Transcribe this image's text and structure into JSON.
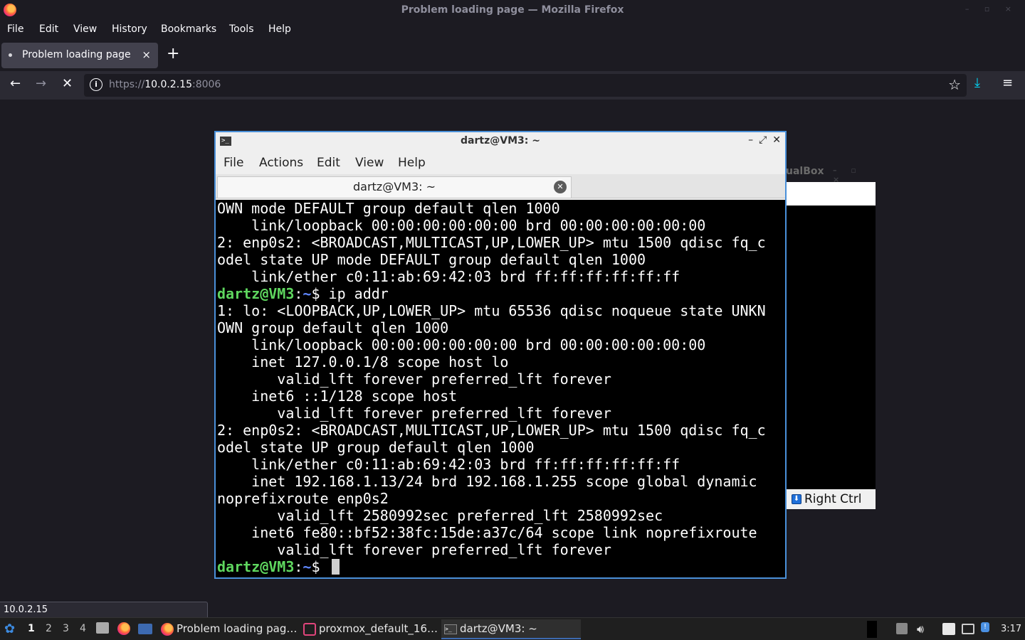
{
  "firefox": {
    "window_title": "Problem loading page — Mozilla Firefox",
    "menu": [
      "File",
      "Edit",
      "View",
      "History",
      "Bookmarks",
      "Tools",
      "Help"
    ],
    "tab_label": "Problem loading page",
    "tab_close": "×",
    "new_tab": "+",
    "url_scheme": "https://",
    "url_host": "10.0.2.15",
    "url_port": ":8006",
    "status_link": "10.0.2.15",
    "icons": [
      "back-arrow-icon",
      "forward-arrow-icon",
      "stop-icon",
      "info-icon",
      "star-icon",
      "download-icon",
      "hamburger-menu-icon"
    ]
  },
  "vbox": {
    "title_fragment": "ualBox",
    "host_key": "Right Ctrl"
  },
  "terminal": {
    "window_title": "dartz@VM3: ~",
    "menu": [
      "File",
      "Actions",
      "Edit",
      "View",
      "Help"
    ],
    "tab_label": "dartz@VM3: ~",
    "prompt_user": "dartz@VM3",
    "prompt_sep": ":",
    "prompt_path": "~",
    "prompt_sign": "$",
    "lines": [
      {
        "type": "out",
        "text": "OWN mode DEFAULT group default qlen 1000"
      },
      {
        "type": "out",
        "text": "    link/loopback 00:00:00:00:00:00 brd 00:00:00:00:00:00"
      },
      {
        "type": "out",
        "text": "2: enp0s2: <BROADCAST,MULTICAST,UP,LOWER_UP> mtu 1500 qdisc fq_c"
      },
      {
        "type": "out",
        "text": "odel state UP mode DEFAULT group default qlen 1000"
      },
      {
        "type": "out",
        "text": "    link/ether c0:11:ab:69:42:03 brd ff:ff:ff:ff:ff:ff"
      },
      {
        "type": "prompt",
        "text": " ip addr"
      },
      {
        "type": "out",
        "text": "1: lo: <LOOPBACK,UP,LOWER_UP> mtu 65536 qdisc noqueue state UNKN"
      },
      {
        "type": "out",
        "text": "OWN group default qlen 1000"
      },
      {
        "type": "out",
        "text": "    link/loopback 00:00:00:00:00:00 brd 00:00:00:00:00:00"
      },
      {
        "type": "out",
        "text": "    inet 127.0.0.1/8 scope host lo"
      },
      {
        "type": "out",
        "text": "       valid_lft forever preferred_lft forever"
      },
      {
        "type": "out",
        "text": "    inet6 ::1/128 scope host"
      },
      {
        "type": "out",
        "text": "       valid_lft forever preferred_lft forever"
      },
      {
        "type": "out",
        "text": "2: enp0s2: <BROADCAST,MULTICAST,UP,LOWER_UP> mtu 1500 qdisc fq_c"
      },
      {
        "type": "out",
        "text": "odel state UP group default qlen 1000"
      },
      {
        "type": "out",
        "text": "    link/ether c0:11:ab:69:42:03 brd ff:ff:ff:ff:ff:ff"
      },
      {
        "type": "out",
        "text": "    inet 192.168.1.13/24 brd 192.168.1.255 scope global dynamic"
      },
      {
        "type": "out",
        "text": "noprefixroute enp0s2"
      },
      {
        "type": "out",
        "text": "       valid_lft 2580992sec preferred_lft 2580992sec"
      },
      {
        "type": "out",
        "text": "    inet6 fe80::bf52:38fc:15de:a37c/64 scope link noprefixroute"
      },
      {
        "type": "out",
        "text": "       valid_lft forever preferred_lft forever"
      },
      {
        "type": "prompt",
        "text": " ",
        "cursor": true
      }
    ]
  },
  "taskbar": {
    "desktops": [
      "1",
      "2",
      "3",
      "4"
    ],
    "tasks": [
      {
        "label": "Problem loading pag…",
        "icon": "firefox-icon"
      },
      {
        "label": "proxmox_default_16…",
        "icon": "virtualbox-icon"
      },
      {
        "label": "dartz@VM3: ~",
        "icon": "terminal-icon"
      }
    ],
    "clock": "3:17"
  }
}
